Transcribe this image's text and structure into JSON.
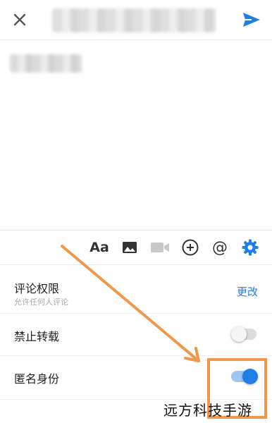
{
  "header": {
    "close_icon": "close-icon",
    "send_icon": "send-icon",
    "accent": "#2b7be0"
  },
  "toolbar": {
    "text_format_label": "Aa",
    "at_label": "@",
    "icons": [
      "text-format-icon",
      "image-icon",
      "video-icon",
      "add-circle-icon",
      "at-icon",
      "gear-icon"
    ]
  },
  "settings": {
    "comment_permission": {
      "title": "评论权限",
      "subtitle": "允许任何人评论",
      "action": "更改"
    },
    "no_repost": {
      "title": "禁止转载",
      "enabled": false
    },
    "anonymous": {
      "title": "匿名身份",
      "enabled": true
    }
  },
  "annotation_color": "#f0974a",
  "watermark": {
    "text": "远方科技手游"
  }
}
